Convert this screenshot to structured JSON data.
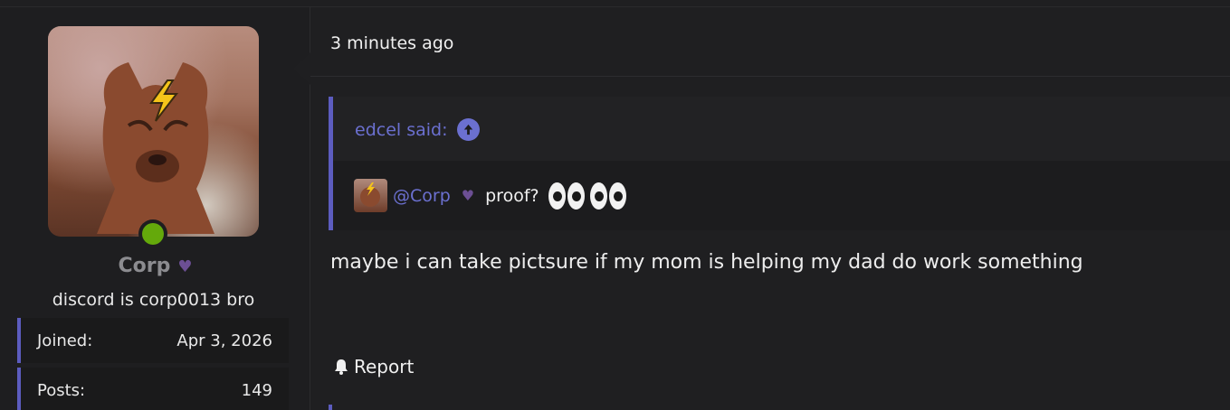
{
  "user": {
    "name": "Corp",
    "title": "discord is corp0013 bro",
    "online": true,
    "heart_icon": "purple-heart-icon",
    "stats": [
      {
        "label": "Joined:",
        "value": "Apr 3, 2026"
      },
      {
        "label": "Posts:",
        "value": "149"
      }
    ]
  },
  "message": {
    "timestamp": "3 minutes ago",
    "quote": {
      "author_label": "edcel said:",
      "mention": "@Corp",
      "text": "proof?",
      "emoji": "eyes-icon x2"
    },
    "body": "maybe i can take pictsure if my mom is helping my dad do work something",
    "report_label": "Report"
  },
  "colors": {
    "accent": "#5c5cbf",
    "link": "#6b70d0",
    "online": "#64a90b",
    "background": "#1f1f21"
  }
}
